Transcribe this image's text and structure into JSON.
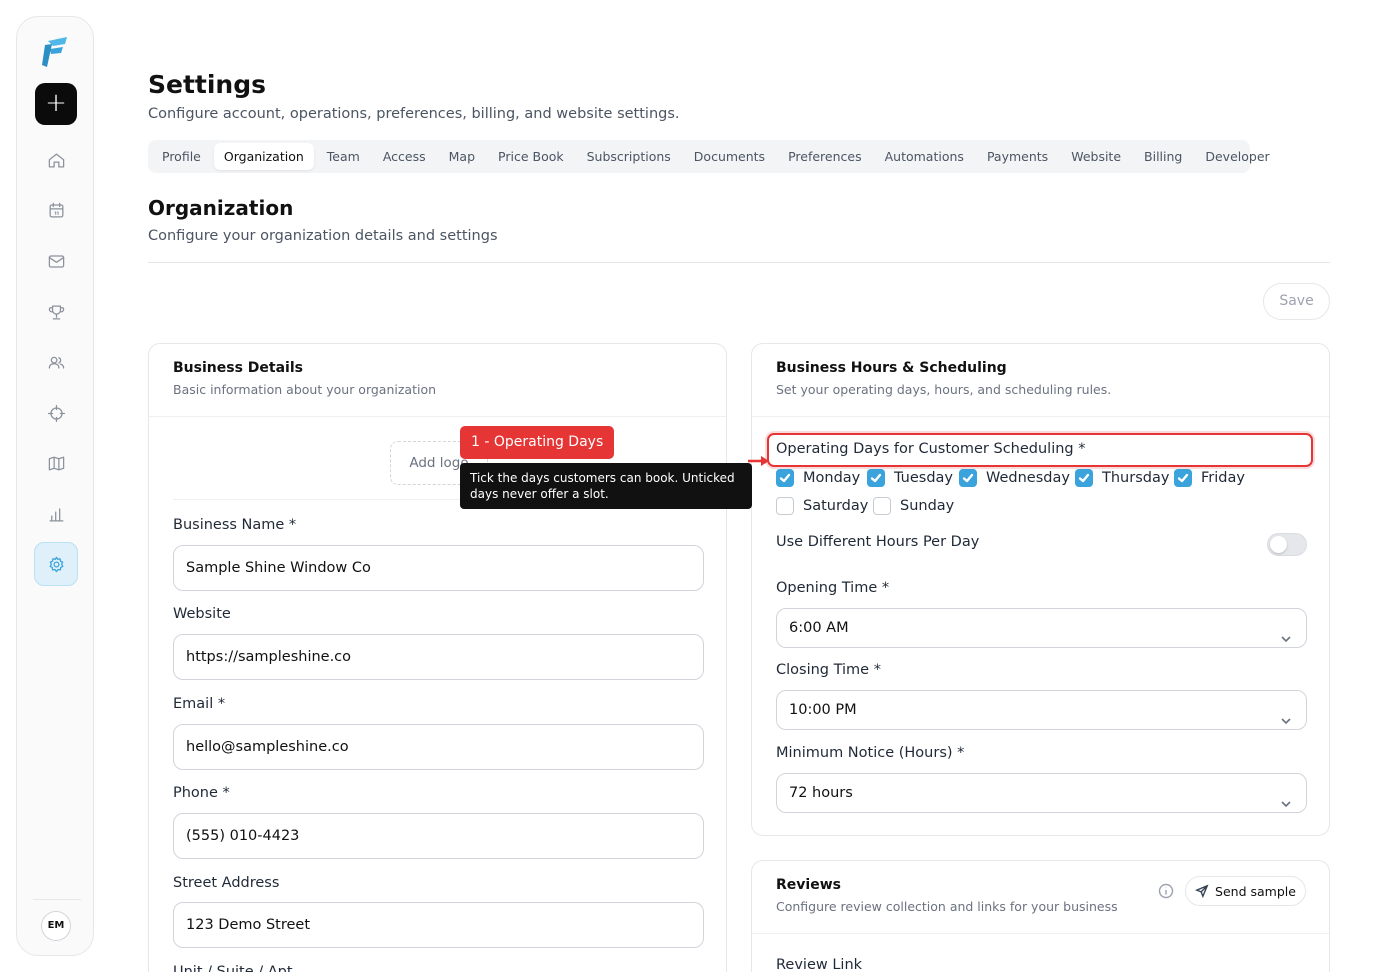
{
  "sidebar": {
    "avatar_initials": "EM",
    "nav_icons": [
      "home-icon",
      "calendar-icon",
      "mail-icon",
      "trophy-icon",
      "users-icon",
      "crosshair-icon",
      "map-icon",
      "bar-chart-icon",
      "gear-icon"
    ],
    "active": "gear-icon",
    "accent_color": "#3aa3db"
  },
  "header": {
    "title": "Settings",
    "subtitle": "Configure account, operations, preferences, billing, and website settings."
  },
  "tabs": [
    {
      "label": "Profile"
    },
    {
      "label": "Organization",
      "active": true
    },
    {
      "label": "Team"
    },
    {
      "label": "Access"
    },
    {
      "label": "Map"
    },
    {
      "label": "Price Book"
    },
    {
      "label": "Subscriptions"
    },
    {
      "label": "Documents"
    },
    {
      "label": "Preferences"
    },
    {
      "label": "Automations"
    },
    {
      "label": "Payments"
    },
    {
      "label": "Website"
    },
    {
      "label": "Billing"
    },
    {
      "label": "Developer"
    }
  ],
  "section": {
    "title": "Organization",
    "subtitle": "Configure your organization details and settings",
    "save_label": "Save"
  },
  "business_details": {
    "title": "Business Details",
    "description": "Basic information about your organization",
    "add_logo_label": "Add logo",
    "fields": {
      "business_name": {
        "label": "Business Name *",
        "value": "Sample Shine Window Co"
      },
      "website": {
        "label": "Website",
        "value": "https://sampleshine.co"
      },
      "email": {
        "label": "Email *",
        "value": "hello@sampleshine.co"
      },
      "phone": {
        "label": "Phone *",
        "value": "(555) 010-4423"
      },
      "street": {
        "label": "Street Address",
        "value": "123 Demo Street"
      },
      "unit": {
        "label": "Unit / Suite / Apt"
      }
    }
  },
  "hours": {
    "title": "Business Hours & Scheduling",
    "description": "Set your operating days, hours, and scheduling rules.",
    "operating_days_label": "Operating Days for Customer Scheduling *",
    "days": [
      {
        "label": "Monday",
        "checked": true
      },
      {
        "label": "Tuesday",
        "checked": true
      },
      {
        "label": "Wednesday",
        "checked": true
      },
      {
        "label": "Thursday",
        "checked": true
      },
      {
        "label": "Friday",
        "checked": true
      },
      {
        "label": "Saturday",
        "checked": false
      },
      {
        "label": "Sunday",
        "checked": false
      }
    ],
    "different_hours_label": "Use Different Hours Per Day",
    "different_hours_on": false,
    "opening_label": "Opening Time *",
    "opening_value": "6:00 AM",
    "closing_label": "Closing Time *",
    "closing_value": "10:00 PM",
    "notice_label": "Minimum Notice (Hours) *",
    "notice_value": "72 hours"
  },
  "reviews": {
    "title": "Reviews",
    "description": "Configure review collection and links for your business",
    "send_sample_label": "Send sample",
    "review_link_label": "Review Link"
  },
  "annotation": {
    "badge": "1 - Operating Days",
    "tooltip": "Tick the days customers can book. Unticked days never offer a slot.",
    "color": "#e53535"
  }
}
